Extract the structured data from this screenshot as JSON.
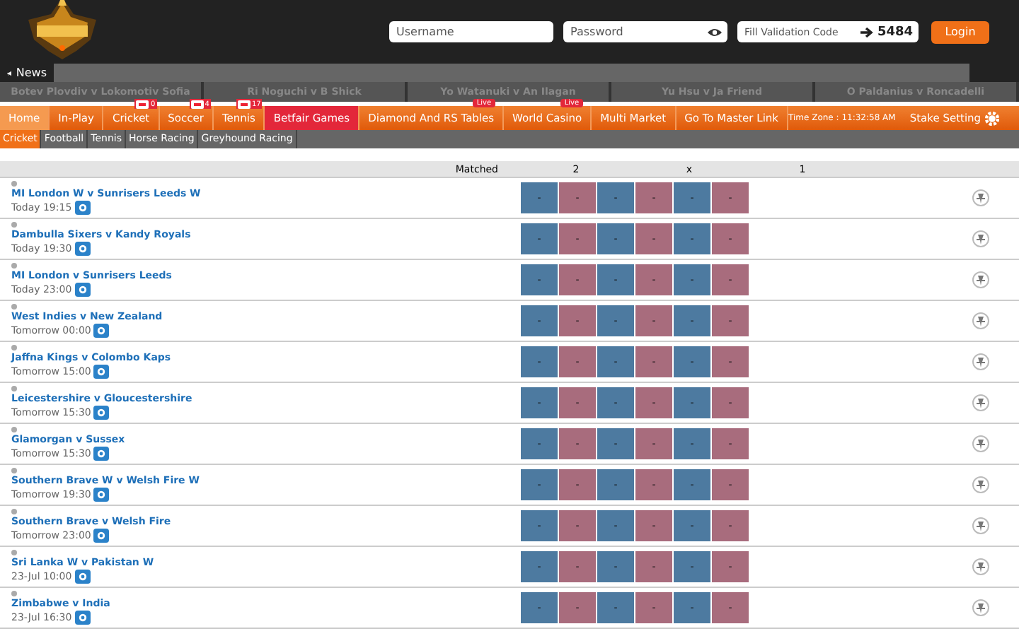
{
  "header": {
    "username": {
      "placeholder": "Username"
    },
    "password": {
      "placeholder": "Password"
    },
    "validation": {
      "placeholder": "Fill Validation Code",
      "code": "5484"
    },
    "login": "Login"
  },
  "news": {
    "label": "News",
    "items": [
      "Botev Plovdiv v Lokomotiv Sofia",
      "Ri Noguchi v B Shick",
      "Yo Watanuki v An Ilagan",
      "Yu Hsu v Ja Friend",
      "O Paldanius v Roncadelli"
    ]
  },
  "nav": {
    "items": [
      {
        "label": "Home",
        "selected": true,
        "highlight": false
      },
      {
        "label": "In-Play",
        "selected": false,
        "highlight": false
      },
      {
        "label": "Cricket",
        "selected": false,
        "highlight": false,
        "count": "0"
      },
      {
        "label": "Soccer",
        "selected": false,
        "highlight": false,
        "count": "4"
      },
      {
        "label": "Tennis",
        "selected": false,
        "highlight": false,
        "count": "17"
      },
      {
        "label": "Betfair Games",
        "selected": false,
        "highlight": true
      },
      {
        "label": "Diamond And RS Tables",
        "selected": false,
        "highlight": false,
        "badge": "Live"
      },
      {
        "label": "World Casino",
        "selected": false,
        "highlight": false,
        "badge": "Live"
      },
      {
        "label": "Multi Market",
        "selected": false,
        "highlight": false
      },
      {
        "label": "Go To Master Link",
        "selected": false,
        "highlight": false
      }
    ],
    "time_zone": "Time Zone : 11:32:58 AM",
    "stake_setting": "Stake Setting"
  },
  "sports": [
    {
      "label": "Cricket",
      "selected": true
    },
    {
      "label": "Football",
      "selected": false
    },
    {
      "label": "Tennis",
      "selected": false
    },
    {
      "label": "Horse Racing",
      "selected": false
    },
    {
      "label": "Greyhound Racing",
      "selected": false
    }
  ],
  "table": {
    "columns": [
      "Matched",
      "2",
      "x",
      "1"
    ],
    "rows": [
      {
        "name": "MI London W v Sunrisers Leeds W",
        "time": "Today 19:15",
        "odds": [
          "-",
          "-",
          "-",
          "-",
          "-",
          "-"
        ]
      },
      {
        "name": "Dambulla Sixers v Kandy Royals",
        "time": "Today 19:30",
        "odds": [
          "-",
          "-",
          "-",
          "-",
          "-",
          "-"
        ]
      },
      {
        "name": "MI London v Sunrisers Leeds",
        "time": "Today 23:00",
        "odds": [
          "-",
          "-",
          "-",
          "-",
          "-",
          "-"
        ]
      },
      {
        "name": "West Indies v New Zealand",
        "time": "Tomorrow 00:00",
        "odds": [
          "-",
          "-",
          "-",
          "-",
          "-",
          "-"
        ]
      },
      {
        "name": "Jaffna Kings v Colombo Kaps",
        "time": "Tomorrow 15:00",
        "odds": [
          "-",
          "-",
          "-",
          "-",
          "-",
          "-"
        ]
      },
      {
        "name": "Leicestershire v Gloucestershire",
        "time": "Tomorrow 15:30",
        "odds": [
          "-",
          "-",
          "-",
          "-",
          "-",
          "-"
        ]
      },
      {
        "name": "Glamorgan v Sussex",
        "time": "Tomorrow 15:30",
        "odds": [
          "-",
          "-",
          "-",
          "-",
          "-",
          "-"
        ]
      },
      {
        "name": "Southern Brave W v Welsh Fire W",
        "time": "Tomorrow 19:30",
        "odds": [
          "-",
          "-",
          "-",
          "-",
          "-",
          "-"
        ]
      },
      {
        "name": "Southern Brave v Welsh Fire",
        "time": "Tomorrow 23:00",
        "odds": [
          "-",
          "-",
          "-",
          "-",
          "-",
          "-"
        ]
      },
      {
        "name": "Sri Lanka W v Pakistan W",
        "time": "23-Jul 10:00",
        "odds": [
          "-",
          "-",
          "-",
          "-",
          "-",
          "-"
        ]
      },
      {
        "name": "Zimbabwe v India",
        "time": "23-Jul 16:30",
        "odds": [
          "-",
          "-",
          "-",
          "-",
          "-",
          "-"
        ]
      }
    ]
  }
}
